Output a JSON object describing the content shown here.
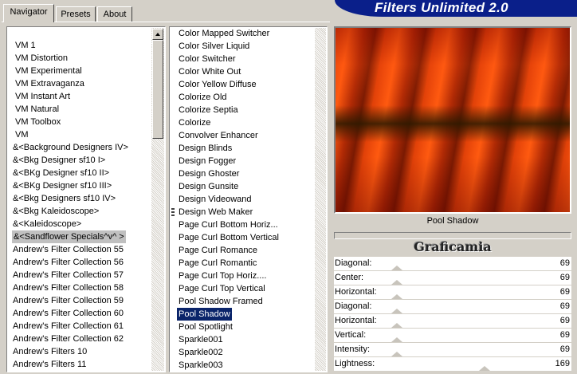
{
  "tabs": [
    {
      "label": "Navigator",
      "active": true
    },
    {
      "label": "Presets",
      "active": false
    },
    {
      "label": "About",
      "active": false
    }
  ],
  "banner_title": "Filters Unlimited 2.0",
  "categories": [
    {
      "label": "VM 1"
    },
    {
      "label": "VM Distortion"
    },
    {
      "label": "VM Experimental"
    },
    {
      "label": "VM Extravaganza"
    },
    {
      "label": "VM Instant Art"
    },
    {
      "label": "VM Natural"
    },
    {
      "label": "VM Toolbox"
    },
    {
      "label": "VM"
    },
    {
      "label": "&<Background Designers IV>"
    },
    {
      "label": "&<Bkg Designer sf10 I>"
    },
    {
      "label": "&<BKg Designer sf10 II>"
    },
    {
      "label": "&<BKg Designer sf10 III>"
    },
    {
      "label": "&<Bkg Designers sf10 IV>"
    },
    {
      "label": "&<Bkg Kaleidoscope>"
    },
    {
      "label": "&<Kaleidoscope>"
    },
    {
      "label": "&<Sandflower Specials^v^ >",
      "selected": true
    },
    {
      "label": "Andrew's Filter Collection 55"
    },
    {
      "label": "Andrew's Filter Collection 56"
    },
    {
      "label": "Andrew's Filter Collection 57"
    },
    {
      "label": "Andrew's Filter Collection 58"
    },
    {
      "label": "Andrew's Filter Collection 59"
    },
    {
      "label": "Andrew's Filter Collection 60"
    },
    {
      "label": "Andrew's Filter Collection 61"
    },
    {
      "label": "Andrew's Filter Collection 62"
    },
    {
      "label": "Andrew's Filters 10"
    },
    {
      "label": "Andrew's Filters 11"
    }
  ],
  "filters": [
    {
      "label": "Color Mapped Switcher"
    },
    {
      "label": "Color Silver Liquid"
    },
    {
      "label": "Color Switcher"
    },
    {
      "label": "Color White Out"
    },
    {
      "label": "Color Yellow Diffuse"
    },
    {
      "label": "Colorize Old"
    },
    {
      "label": "Colorize Septia"
    },
    {
      "label": "Colorize"
    },
    {
      "label": "Convolver Enhancer"
    },
    {
      "label": "Design Blinds"
    },
    {
      "label": "Design Fogger"
    },
    {
      "label": "Design Ghoster"
    },
    {
      "label": "Design Gunsite"
    },
    {
      "label": "Design Videowand"
    },
    {
      "label": "Design Web Maker"
    },
    {
      "label": "Page Curl Bottom Horiz..."
    },
    {
      "label": "Page Curl Bottom Vertical"
    },
    {
      "label": "Page Curl Romance"
    },
    {
      "label": "Page Curl Romantic"
    },
    {
      "label": "Page Curl Top Horiz...."
    },
    {
      "label": "Page Curl Top Vertical"
    },
    {
      "label": "Pool Shadow Framed"
    },
    {
      "label": "Pool Shadow",
      "selected": true
    },
    {
      "label": "Pool Spotlight"
    },
    {
      "label": "Sparkle001"
    },
    {
      "label": "Sparkle002"
    },
    {
      "label": "Sparkle003"
    }
  ],
  "preview": {
    "caption": "Pool Shadow"
  },
  "logo_text": "Graficamia",
  "sliders": [
    {
      "label": "Diagonal:",
      "value": "69"
    },
    {
      "label": "Center:",
      "value": "69"
    },
    {
      "label": "Horizontal:",
      "value": "69"
    },
    {
      "label": "Diagonal:",
      "value": "69"
    },
    {
      "label": "Horizontal:",
      "value": "69"
    },
    {
      "label": "Vertical:",
      "value": "69"
    },
    {
      "label": "Intensity:",
      "value": "69"
    },
    {
      "label": "Lightness:",
      "value": "169"
    }
  ],
  "colors": {
    "banner": "#0a1f8a",
    "selection": "#0a246a",
    "window": "#d4d0c8"
  }
}
